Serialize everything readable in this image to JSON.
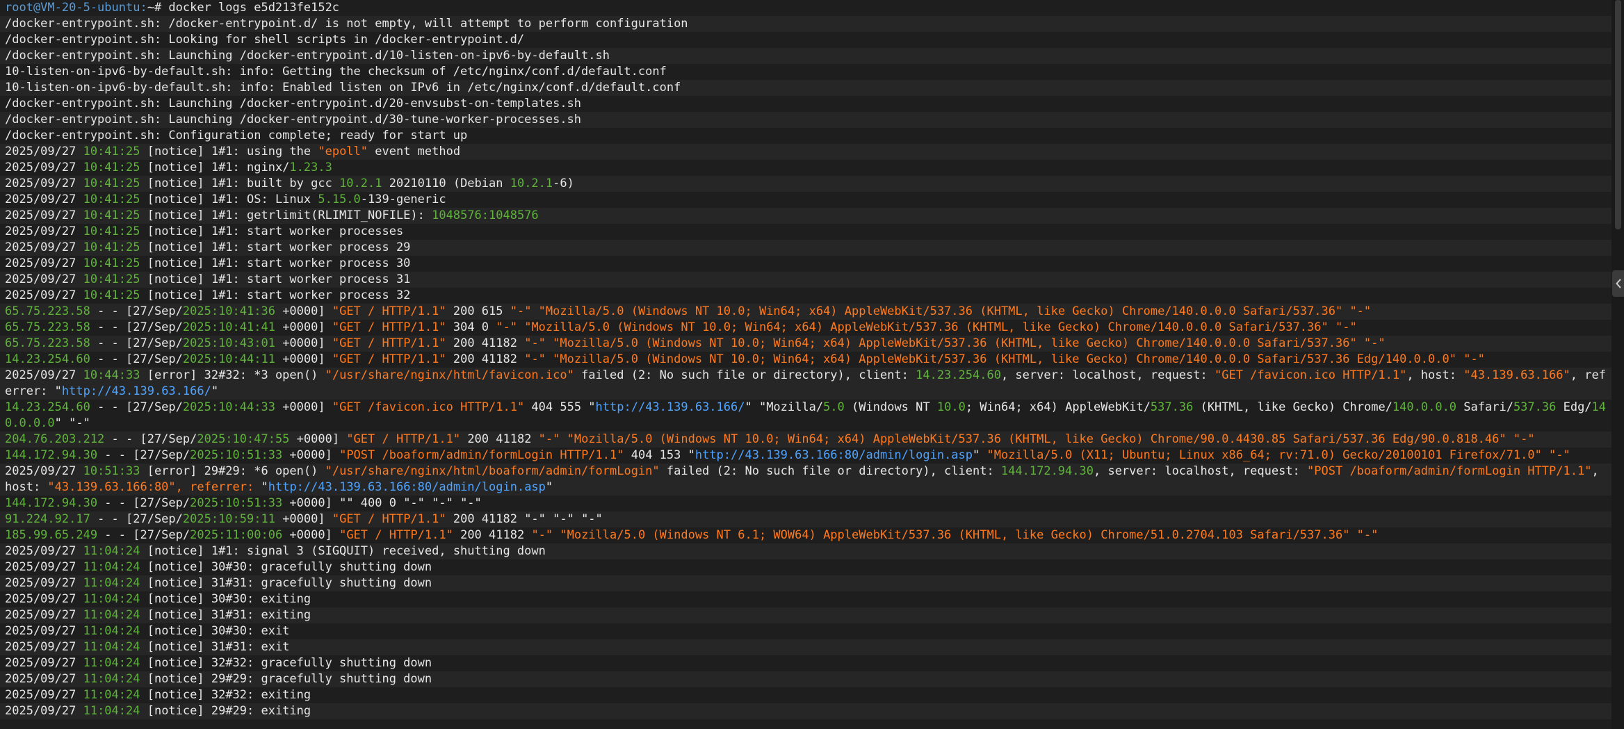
{
  "terminal": {
    "lines": [
      [
        [
          "root@VM-20-5-ubuntu:",
          "prompt-user"
        ],
        [
          "~# docker logs e5d213fe152c",
          "w"
        ]
      ],
      [
        [
          "/docker-entrypoint.sh: /docker-entrypoint.d/ is not empty, will attempt to perform configuration",
          "w"
        ]
      ],
      [
        [
          "/docker-entrypoint.sh: Looking for shell scripts in /docker-entrypoint.d/",
          "w"
        ]
      ],
      [
        [
          "/docker-entrypoint.sh: Launching /docker-entrypoint.d/10-listen-on-ipv6-by-default.sh",
          "w"
        ]
      ],
      [
        [
          "10-listen-on-ipv6-by-default.sh: info: Getting the checksum of /etc/nginx/conf.d/default.conf",
          "w"
        ]
      ],
      [
        [
          "10-listen-on-ipv6-by-default.sh: info: Enabled listen on IPv6 in /etc/nginx/conf.d/default.conf",
          "w"
        ]
      ],
      [
        [
          "/docker-entrypoint.sh: Launching /docker-entrypoint.d/20-envsubst-on-templates.sh",
          "w"
        ]
      ],
      [
        [
          "/docker-entrypoint.sh: Launching /docker-entrypoint.d/30-tune-worker-processes.sh",
          "w"
        ]
      ],
      [
        [
          "/docker-entrypoint.sh: Configuration complete; ready for start up",
          "w"
        ]
      ],
      [
        [
          "2025/09/27 ",
          "w"
        ],
        [
          "10:41:25",
          "g"
        ],
        [
          " [notice] 1#1: using the ",
          "w"
        ],
        [
          "\"epoll\"",
          "o"
        ],
        [
          " event method",
          "w"
        ]
      ],
      [
        [
          "2025/09/27 ",
          "w"
        ],
        [
          "10:41:25",
          "g"
        ],
        [
          " [notice] 1#1: nginx/",
          "w"
        ],
        [
          "1.23.3",
          "g"
        ]
      ],
      [
        [
          "2025/09/27 ",
          "w"
        ],
        [
          "10:41:25",
          "g"
        ],
        [
          " [notice] 1#1: built by gcc ",
          "w"
        ],
        [
          "10.2.1",
          "g"
        ],
        [
          " 20210110 (Debian ",
          "w"
        ],
        [
          "10.2.1",
          "g"
        ],
        [
          "-6)",
          "w"
        ]
      ],
      [
        [
          "2025/09/27 ",
          "w"
        ],
        [
          "10:41:25",
          "g"
        ],
        [
          " [notice] 1#1: OS: Linux ",
          "w"
        ],
        [
          "5.15.0",
          "g"
        ],
        [
          "-139-generic",
          "w"
        ]
      ],
      [
        [
          "2025/09/27 ",
          "w"
        ],
        [
          "10:41:25",
          "g"
        ],
        [
          " [notice] 1#1: getrlimit(RLIMIT_NOFILE): ",
          "w"
        ],
        [
          "1048576:1048576",
          "g"
        ]
      ],
      [
        [
          "2025/09/27 ",
          "w"
        ],
        [
          "10:41:25",
          "g"
        ],
        [
          " [notice] 1#1: start worker processes",
          "w"
        ]
      ],
      [
        [
          "2025/09/27 ",
          "w"
        ],
        [
          "10:41:25",
          "g"
        ],
        [
          " [notice] 1#1: start worker process 29",
          "w"
        ]
      ],
      [
        [
          "2025/09/27 ",
          "w"
        ],
        [
          "10:41:25",
          "g"
        ],
        [
          " [notice] 1#1: start worker process 30",
          "w"
        ]
      ],
      [
        [
          "2025/09/27 ",
          "w"
        ],
        [
          "10:41:25",
          "g"
        ],
        [
          " [notice] 1#1: start worker process 31",
          "w"
        ]
      ],
      [
        [
          "2025/09/27 ",
          "w"
        ],
        [
          "10:41:25",
          "g"
        ],
        [
          " [notice] 1#1: start worker process 32",
          "w"
        ]
      ],
      [
        [
          "65.75.223.58",
          "g"
        ],
        [
          " - - [27/Sep/",
          "w"
        ],
        [
          "2025:10:41:36",
          "g"
        ],
        [
          " +0000] ",
          "w"
        ],
        [
          "\"GET / HTTP/1.1\"",
          "o"
        ],
        [
          " 200 615 ",
          "w"
        ],
        [
          "\"-\" \"Mozilla/5.0 (Windows NT 10.0; Win64; x64) AppleWebKit/537.36 (KHTML, like Gecko) Chrome/140.0.0.0 Safari/537.36\" \"-\"",
          "o"
        ]
      ],
      [
        [
          "65.75.223.58",
          "g"
        ],
        [
          " - - [27/Sep/",
          "w"
        ],
        [
          "2025:10:41:41",
          "g"
        ],
        [
          " +0000] ",
          "w"
        ],
        [
          "\"GET / HTTP/1.1\"",
          "o"
        ],
        [
          " 304 0 ",
          "w"
        ],
        [
          "\"-\" \"Mozilla/5.0 (Windows NT 10.0; Win64; x64) AppleWebKit/537.36 (KHTML, like Gecko) Chrome/140.0.0.0 Safari/537.36\" \"-\"",
          "o"
        ]
      ],
      [
        [
          "65.75.223.58",
          "g"
        ],
        [
          " - - [27/Sep/",
          "w"
        ],
        [
          "2025:10:43:01",
          "g"
        ],
        [
          " +0000] ",
          "w"
        ],
        [
          "\"GET / HTTP/1.1\"",
          "o"
        ],
        [
          " 200 41182 ",
          "w"
        ],
        [
          "\"-\" \"Mozilla/5.0 (Windows NT 10.0; Win64; x64) AppleWebKit/537.36 (KHTML, like Gecko) Chrome/140.0.0.0 Safari/537.36\" \"-\"",
          "o"
        ]
      ],
      [
        [
          "14.23.254.60",
          "g"
        ],
        [
          " - - [27/Sep/",
          "w"
        ],
        [
          "2025:10:44:11",
          "g"
        ],
        [
          " +0000] ",
          "w"
        ],
        [
          "\"GET / HTTP/1.1\"",
          "o"
        ],
        [
          " 200 41182 ",
          "w"
        ],
        [
          "\"-\" \"Mozilla/5.0 (Windows NT 10.0; Win64; x64) AppleWebKit/537.36 (KHTML, like Gecko) Chrome/140.0.0.0 Safari/537.36 Edg/140.0.0.0\" \"-\"",
          "o"
        ]
      ],
      [
        [
          "2025/09/27 ",
          "w"
        ],
        [
          "10:44:33",
          "g"
        ],
        [
          " [error] 32#32: *3 open() ",
          "w"
        ],
        [
          "\"/usr/share/nginx/html/favicon.ico\"",
          "o"
        ],
        [
          " failed (2: No such file or directory), client: ",
          "w"
        ],
        [
          "14.23.254.60",
          "g"
        ],
        [
          ", server: localhost, request: ",
          "w"
        ],
        [
          "\"GET /favicon.ico HTTP/1.1\"",
          "o"
        ],
        [
          ", host: ",
          "w"
        ],
        [
          "\"43.139.63.166\"",
          "o"
        ],
        [
          ", referrer: ",
          "w"
        ],
        [
          "\"",
          "w"
        ],
        [
          "http://43.139.63.166/",
          "b"
        ],
        [
          "\"",
          "w"
        ]
      ],
      [
        [
          "14.23.254.60",
          "g"
        ],
        [
          " - - [27/Sep/",
          "w"
        ],
        [
          "2025:10:44:33",
          "g"
        ],
        [
          " +0000] ",
          "w"
        ],
        [
          "\"GET /favicon.ico HTTP/1.1\"",
          "o"
        ],
        [
          " 404 555 \"",
          "w"
        ],
        [
          "http://43.139.63.166/",
          "b"
        ],
        [
          "\" \"Mozilla/",
          "w"
        ],
        [
          "5.0",
          "g"
        ],
        [
          " (Windows NT ",
          "w"
        ],
        [
          "10.0",
          "g"
        ],
        [
          "; Win64; x64) AppleWebKit/",
          "w"
        ],
        [
          "537.36",
          "g"
        ],
        [
          " (KHTML, like Gecko) Chrome/",
          "w"
        ],
        [
          "140.0.0.0",
          "g"
        ],
        [
          " Safari/",
          "w"
        ],
        [
          "537.36",
          "g"
        ],
        [
          " Edg/",
          "w"
        ],
        [
          "140.0.0.0",
          "g"
        ],
        [
          "\" \"-\"",
          "w"
        ]
      ],
      [
        [
          "204.76.203.212",
          "g"
        ],
        [
          " - - [27/Sep/",
          "w"
        ],
        [
          "2025:10:47:55",
          "g"
        ],
        [
          " +0000] ",
          "w"
        ],
        [
          "\"GET / HTTP/1.1\"",
          "o"
        ],
        [
          " 200 41182 ",
          "w"
        ],
        [
          "\"-\" \"Mozilla/5.0 (Windows NT 10.0; Win64; x64) AppleWebKit/537.36 (KHTML, like Gecko) Chrome/90.0.4430.85 Safari/537.36 Edg/90.0.818.46\" \"-\"",
          "o"
        ]
      ],
      [
        [
          "144.172.94.30",
          "g"
        ],
        [
          " - - [27/Sep/",
          "w"
        ],
        [
          "2025:10:51:33",
          "g"
        ],
        [
          " +0000] ",
          "w"
        ],
        [
          "\"POST /boaform/admin/formLogin HTTP/1.1\"",
          "o"
        ],
        [
          " 404 153 \"",
          "w"
        ],
        [
          "http://43.139.63.166:80/admin/login.asp",
          "b"
        ],
        [
          "\" ",
          "w"
        ],
        [
          "\"Mozilla/5.0 (X11; Ubuntu; Linux x86_64; rv:71.0) Gecko/20100101 Firefox/71.0\" \"-\"",
          "o"
        ]
      ],
      [
        [
          "2025/09/27 ",
          "w"
        ],
        [
          "10:51:33",
          "g"
        ],
        [
          " [error] 29#29: *6 open() ",
          "w"
        ],
        [
          "\"/usr/share/nginx/html/boaform/admin/formLogin\"",
          "o"
        ],
        [
          " failed (2: No such file or directory), client: ",
          "w"
        ],
        [
          "144.172.94.30",
          "g"
        ],
        [
          ", server: localhost, request: ",
          "w"
        ],
        [
          "\"POST /boaform/admin/formLogin HTTP/1.1\"",
          "o"
        ],
        [
          ", host: ",
          "w"
        ],
        [
          "\"43.139.63.166:80\"",
          "o"
        ],
        [
          ", referrer: ",
          "o"
        ],
        [
          "\"",
          "w"
        ],
        [
          "http://43.139.63.166:80/admin/login.asp",
          "b"
        ],
        [
          "\"",
          "w"
        ]
      ],
      [
        [
          "144.172.94.30",
          "g"
        ],
        [
          " - - [27/Sep/",
          "w"
        ],
        [
          "2025:10:51:33",
          "g"
        ],
        [
          " +0000] ",
          "w"
        ],
        [
          "\"\" 400 0 \"-\" \"-\" \"-\"",
          "w"
        ]
      ],
      [
        [
          "91.224.92.17",
          "g"
        ],
        [
          " - - [27/Sep/",
          "w"
        ],
        [
          "2025:10:59:11",
          "g"
        ],
        [
          " +0000] ",
          "w"
        ],
        [
          "\"GET / HTTP/1.1\"",
          "o"
        ],
        [
          " 200 41182 \"-\" \"-\" \"-\"",
          "w"
        ]
      ],
      [
        [
          "185.99.65.249",
          "g"
        ],
        [
          " - - [27/Sep/",
          "w"
        ],
        [
          "2025:11:00:06",
          "g"
        ],
        [
          " +0000] ",
          "w"
        ],
        [
          "\"GET / HTTP/1.1\"",
          "o"
        ],
        [
          " 200 41182 ",
          "w"
        ],
        [
          "\"-\" \"Mozilla/5.0 (Windows NT 6.1; WOW64) AppleWebKit/537.36 (KHTML, like Gecko) Chrome/51.0.2704.103 Safari/537.36\" \"-\"",
          "o"
        ]
      ],
      [
        [
          "2025/09/27 ",
          "w"
        ],
        [
          "11:04:24",
          "g"
        ],
        [
          " [notice] 1#1: signal 3 (SIGQUIT) received, shutting down",
          "w"
        ]
      ],
      [
        [
          "2025/09/27 ",
          "w"
        ],
        [
          "11:04:24",
          "g"
        ],
        [
          " [notice] 30#30: gracefully shutting down",
          "w"
        ]
      ],
      [
        [
          "2025/09/27 ",
          "w"
        ],
        [
          "11:04:24",
          "g"
        ],
        [
          " [notice] 31#31: gracefully shutting down",
          "w"
        ]
      ],
      [
        [
          "2025/09/27 ",
          "w"
        ],
        [
          "11:04:24",
          "g"
        ],
        [
          " [notice] 30#30: exiting",
          "w"
        ]
      ],
      [
        [
          "2025/09/27 ",
          "w"
        ],
        [
          "11:04:24",
          "g"
        ],
        [
          " [notice] 31#31: exiting",
          "w"
        ]
      ],
      [
        [
          "2025/09/27 ",
          "w"
        ],
        [
          "11:04:24",
          "g"
        ],
        [
          " [notice] 30#30: exit",
          "w"
        ]
      ],
      [
        [
          "2025/09/27 ",
          "w"
        ],
        [
          "11:04:24",
          "g"
        ],
        [
          " [notice] 31#31: exit",
          "w"
        ]
      ],
      [
        [
          "2025/09/27 ",
          "w"
        ],
        [
          "11:04:24",
          "g"
        ],
        [
          " [notice] 32#32: gracefully shutting down",
          "w"
        ]
      ],
      [
        [
          "2025/09/27 ",
          "w"
        ],
        [
          "11:04:24",
          "g"
        ],
        [
          " [notice] 29#29: gracefully shutting down",
          "w"
        ]
      ],
      [
        [
          "2025/09/27 ",
          "w"
        ],
        [
          "11:04:24",
          "g"
        ],
        [
          " [notice] 32#32: exiting",
          "w"
        ]
      ],
      [
        [
          "2025/09/27 ",
          "w"
        ],
        [
          "11:04:24",
          "g"
        ],
        [
          " [notice] 29#29: exiting",
          "w"
        ]
      ]
    ]
  },
  "colors": {
    "background": "#1e1e1e",
    "text": "#e6e6e6",
    "green": "#5fb33a",
    "orange": "#ff7a1f",
    "blue": "#4ea3ff"
  },
  "icons": {
    "side_panel_toggle": "chevron-left-icon"
  }
}
